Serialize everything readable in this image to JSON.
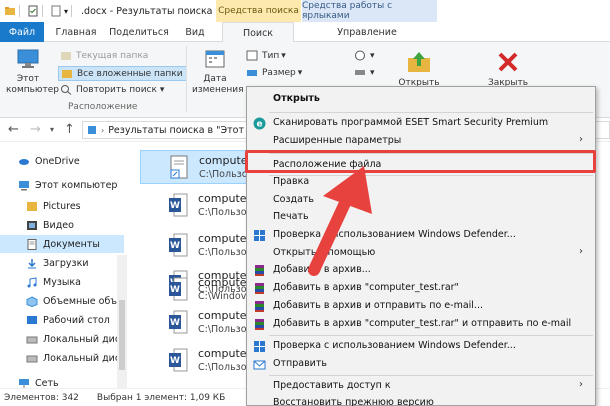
{
  "window": {
    "title": ".docx - Результаты поиска в...",
    "context_tab_search": "Средства поиска",
    "context_tab_shortcut": "Средства работы с ярлыками"
  },
  "ribbon_tabs": [
    "Файл",
    "Главная",
    "Поделиться",
    "Вид",
    "Поиск",
    "Управление"
  ],
  "ribbon": {
    "this_pc": "Этот\nкомпьютер",
    "current_folder": "Текущая папка",
    "all_subfolders": "Все вложенные папки",
    "search_again": "Повторить поиск",
    "location_group": "Расположение",
    "date_modified": "Дата\nизменения",
    "type": "Тип",
    "size": "Размер",
    "open": "Открыть",
    "close": "Закрыть"
  },
  "address": {
    "path": "Результаты поиска в \"Этот ко"
  },
  "nav": {
    "items": [
      {
        "label": "OneDrive"
      },
      {
        "label": "Этот компьютер"
      },
      {
        "label": "Pictures"
      },
      {
        "label": "Видео"
      },
      {
        "label": "Документы"
      },
      {
        "label": "Загрузки"
      },
      {
        "label": "Музыка"
      },
      {
        "label": "Объемные объе"
      },
      {
        "label": "Рабочий стол"
      },
      {
        "label": "Локальный дис"
      },
      {
        "label": "Локальный дис"
      },
      {
        "label": "Сеть"
      }
    ]
  },
  "results": [
    {
      "name": "compute",
      "path": "C:\\Пользо"
    },
    {
      "name": "compute",
      "path": "C:\\Пользо"
    },
    {
      "name": "compute",
      "path": "C:\\Пользо"
    },
    {
      "name": "compute",
      "path": "C:\\Пользо"
    },
    {
      "name": "compute",
      "path": "C:\\Windov"
    },
    {
      "name": "compute",
      "path": "C:\\Пользо"
    },
    {
      "name": "compute",
      "path": "C:\\Пользо"
    }
  ],
  "status": {
    "count": "Элементов: 342",
    "selected": "Выбран 1 элемент: 1,09 КБ"
  },
  "context_menu": {
    "items": [
      {
        "label": "Открыть",
        "bold": true
      },
      {
        "label": "Сканировать программой ESET Smart Security Premium"
      },
      {
        "label": "Расширенные параметры"
      },
      {
        "label": "Расположение файла"
      },
      {
        "label": "Правка"
      },
      {
        "label": "Создать"
      },
      {
        "label": "Печать"
      },
      {
        "label": "Проверка с использованием Windows Defender..."
      },
      {
        "label": "Открыть с помощью"
      },
      {
        "label": "Добавить в архив..."
      },
      {
        "label": "Добавить в архив \"computer_test.rar\""
      },
      {
        "label": "Добавить в архив и отправить по e-mail..."
      },
      {
        "label": "Добавить в архив \"computer_test.rar\" и отправить по e-mail"
      },
      {
        "label": "Проверка с использованием Windows Defender..."
      },
      {
        "label": "Отправить"
      },
      {
        "label": "Предоставить доступ к"
      },
      {
        "label": "Восстановить прежнюю версию"
      }
    ]
  },
  "colors": {
    "accent": "#1979ca",
    "highlight": "#e8423f",
    "selection": "#cce8ff"
  }
}
